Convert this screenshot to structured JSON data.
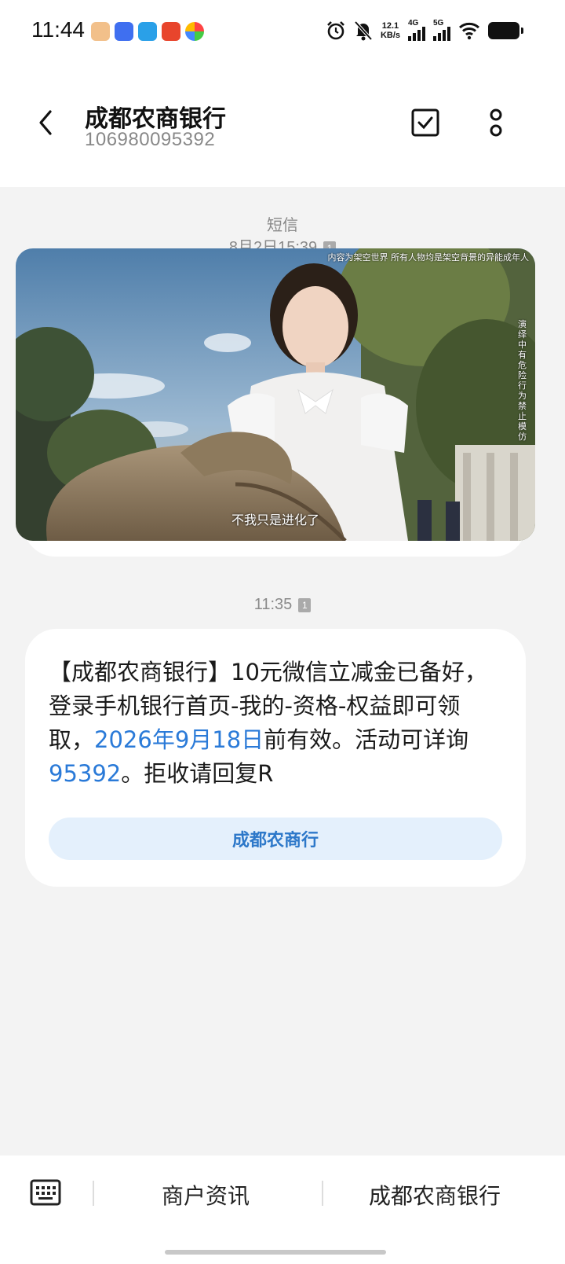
{
  "status_bar": {
    "time": "11:44",
    "net_speed_value": "12.1",
    "net_speed_unit": "KB/s",
    "signal1_label": "4G",
    "signal2_label": "5G",
    "icons": [
      "alarm-icon",
      "mute-icon",
      "wifi-icon",
      "battery-icon"
    ]
  },
  "header": {
    "contact_name": "成都农商银行",
    "contact_number": "106980095392"
  },
  "conversation": {
    "sms_label": "短信",
    "first_time": "8月2日15:39",
    "message_time": "11:35",
    "sim_badge": "1",
    "message": {
      "part1": "【成都农商银行】10元微信立减金已备好，登录手机银行首页-我的-资格-权益即可领取，",
      "date_link": "2026年9月18日",
      "part2": "前有效。活动可详询",
      "phone_link": "95392",
      "part3": "。拒收请回复R"
    },
    "action_button": "成都农商行"
  },
  "video_overlay": {
    "top_caption": "内容为架空世界 所有人物均是架空背景的异能成年人",
    "side_caption": "演绎中有危险行为 禁止模仿",
    "subtitle": "不我只是进化了"
  },
  "bottom_bar": {
    "menu1": "商户资讯",
    "menu2": "成都农商银行"
  }
}
